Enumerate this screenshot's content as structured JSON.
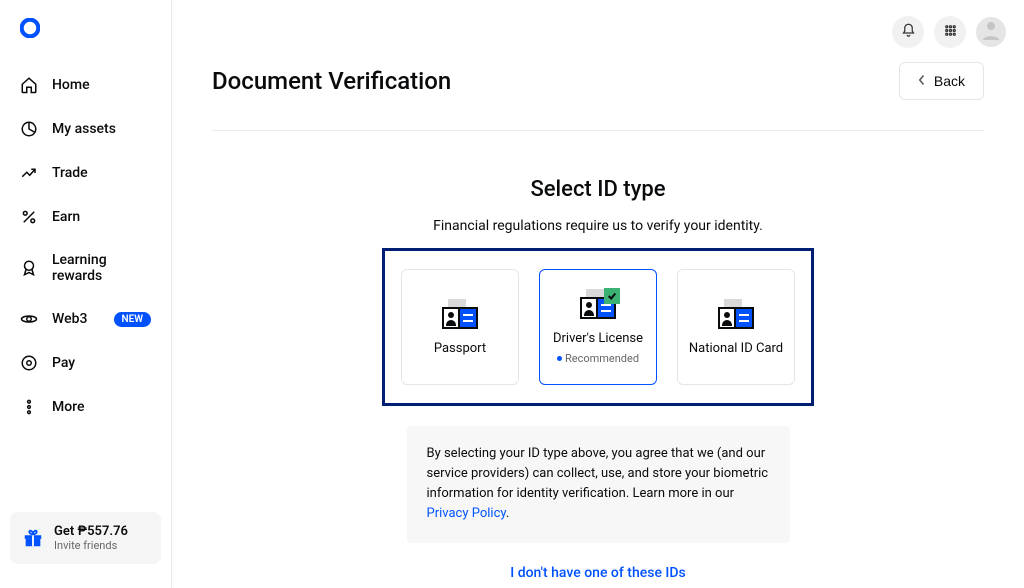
{
  "sidebar": {
    "items": [
      {
        "label": "Home"
      },
      {
        "label": "My assets"
      },
      {
        "label": "Trade"
      },
      {
        "label": "Earn"
      },
      {
        "label": "Learning rewards"
      },
      {
        "label": "Web3",
        "badge": "NEW"
      },
      {
        "label": "Pay"
      },
      {
        "label": "More"
      }
    ],
    "invite": {
      "title": "Get ₱557.76",
      "subtitle": "Invite friends"
    }
  },
  "header": {
    "title": "Document Verification",
    "back": "Back"
  },
  "verify": {
    "title": "Select ID type",
    "subtitle": "Financial regulations require us to verify your identity.",
    "cards": [
      {
        "label": "Passport"
      },
      {
        "label": "Driver's License",
        "recommended": "Recommended"
      },
      {
        "label": "National ID Card"
      }
    ],
    "consent_prefix": "By selecting your ID type above, you agree that we (and our service providers) can collect, use, and store your biometric information for identity verification. Learn more in our ",
    "consent_link": "Privacy Policy",
    "consent_suffix": ".",
    "alt_link": "I don't have one of these IDs"
  }
}
